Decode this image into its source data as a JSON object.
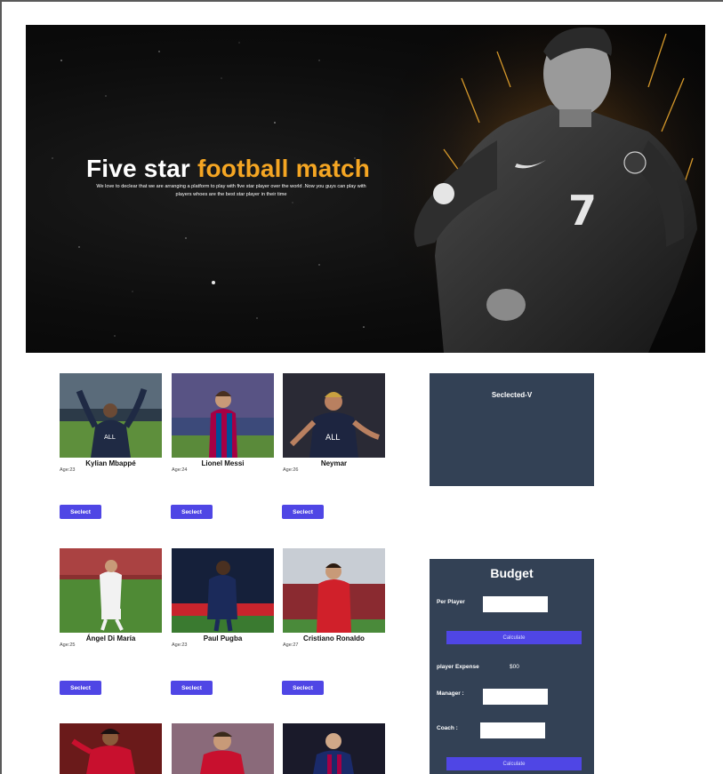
{
  "banner": {
    "title_main": "Five star ",
    "title_accent": "football match",
    "description": "We love to declear that we are arranging a platform to play with five star player over the world .Now you guys can play with players whoes are the best star player in their time",
    "hero_number": "7"
  },
  "players": [
    {
      "name": "Kylian Mbappé",
      "age": "Age:23",
      "select_label": "Seclect"
    },
    {
      "name": "Lionel Messi",
      "age": "Age:24",
      "select_label": "Seclect"
    },
    {
      "name": "Neymar",
      "age": "Age:26",
      "select_label": "Seclect"
    },
    {
      "name": "Ángel Di María",
      "age": "Age:25",
      "select_label": "Seclect"
    },
    {
      "name": "Paul Pugba",
      "age": "Age:23",
      "select_label": "Seclect"
    },
    {
      "name": "Cristiano Ronaldo",
      "age": "Age:27",
      "select_label": "Seclect"
    }
  ],
  "selected_panel": {
    "title": "Seclected-V"
  },
  "budget": {
    "title": "Budget",
    "per_player_label": "Per Player",
    "calculate_label": "Calculate",
    "player_expense_label": "player Expense",
    "player_expense_value": "$00",
    "manager_label": "Manager :",
    "coach_label": "Coach :",
    "calculate_total_label": "Calculate"
  },
  "colors": {
    "accent": "#f5a623",
    "button": "#4f46e5",
    "panel": "#334155"
  }
}
